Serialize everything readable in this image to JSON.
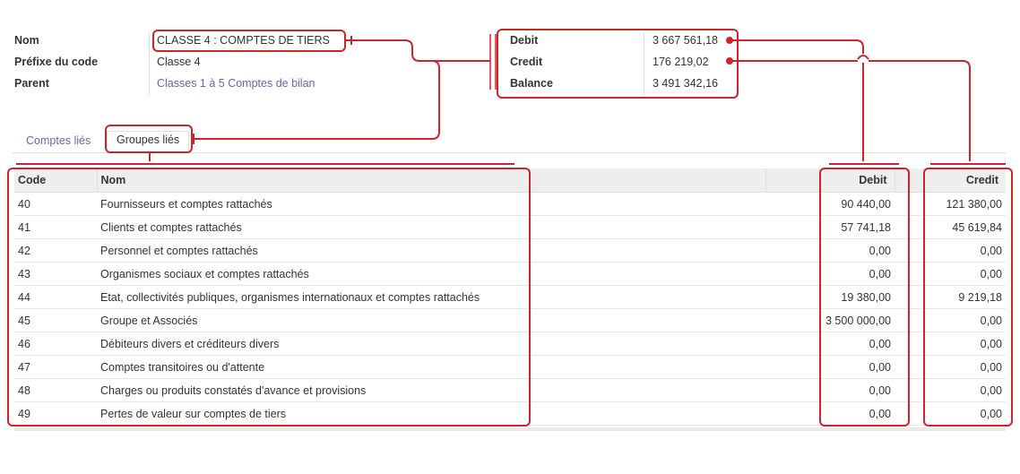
{
  "form": {
    "fields": [
      {
        "label": "Nom",
        "value": "CLASSE 4 : COMPTES DE TIERS"
      },
      {
        "label": "Préfixe du code",
        "value": "Classe 4"
      },
      {
        "label": "Parent",
        "value": "Classes 1 à 5 Comptes de bilan"
      }
    ],
    "totals": [
      {
        "label": "Debit",
        "value": "3 667 561,18"
      },
      {
        "label": "Credit",
        "value": "176 219,02"
      },
      {
        "label": "Balance",
        "value": "3 491 342,16"
      }
    ]
  },
  "tabs": [
    {
      "label": "Comptes liés",
      "active": false
    },
    {
      "label": "Groupes liés",
      "active": true
    }
  ],
  "table": {
    "headers": {
      "code": "Code",
      "name": "Nom",
      "debit": "Debit",
      "credit": "Credit"
    },
    "rows": [
      {
        "code": "40",
        "name": "Fournisseurs et comptes rattachés",
        "debit": "90 440,00",
        "credit": "121 380,00"
      },
      {
        "code": "41",
        "name": "Clients et comptes rattachés",
        "debit": "57 741,18",
        "credit": "45 619,84"
      },
      {
        "code": "42",
        "name": "Personnel et comptes rattachés",
        "debit": "0,00",
        "credit": "0,00"
      },
      {
        "code": "43",
        "name": "Organismes sociaux et comptes rattachés",
        "debit": "0,00",
        "credit": "0,00"
      },
      {
        "code": "44",
        "name": "Etat, collectivités publiques, organismes internationaux et comptes rattachés",
        "debit": "19 380,00",
        "credit": "9 219,18"
      },
      {
        "code": "45",
        "name": "Groupe et Associés",
        "debit": "3 500 000,00",
        "credit": "0,00"
      },
      {
        "code": "46",
        "name": "Débiteurs divers et créditeurs divers",
        "debit": "0,00",
        "credit": "0,00"
      },
      {
        "code": "47",
        "name": "Comptes transitoires ou d'attente",
        "debit": "0,00",
        "credit": "0,00"
      },
      {
        "code": "48",
        "name": "Charges ou produits constatés d'avance et provisions",
        "debit": "0,00",
        "credit": "0,00"
      },
      {
        "code": "49",
        "name": "Pertes de valeur sur comptes de tiers",
        "debit": "0,00",
        "credit": "0,00"
      }
    ]
  },
  "colors": {
    "annotation": "#d0232b",
    "link": "#6f62a4"
  }
}
